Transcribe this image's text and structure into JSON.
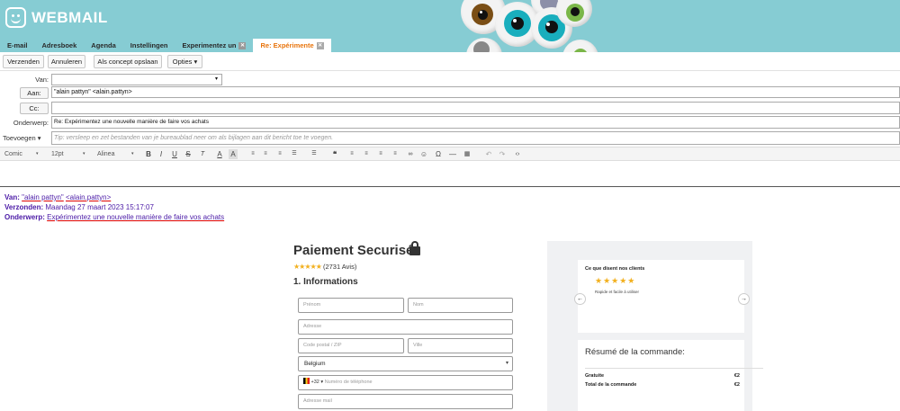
{
  "header": {
    "logo_text": "WEBMAIL",
    "tabs": [
      {
        "label": "E-mail",
        "closable": false,
        "active": false
      },
      {
        "label": "Adresboek",
        "closable": false,
        "active": false
      },
      {
        "label": "Agenda",
        "closable": false,
        "active": false
      },
      {
        "label": "Instellingen",
        "closable": false,
        "active": false
      },
      {
        "label": "Experimentez un",
        "closable": true,
        "active": false
      },
      {
        "label": "Re: Expérimente",
        "closable": true,
        "active": true
      }
    ],
    "close_glyph": "✕"
  },
  "toolbar": {
    "send": "Verzenden",
    "cancel": "Annuleren",
    "save_draft": "Als concept opslaan",
    "options": "Opties ▾"
  },
  "compose": {
    "from_label": "Van:",
    "from_value": "",
    "to_label": "Aan:",
    "to_value": "\"alain pattyn\" <alain.pattyn>",
    "cc_label": "Cc:",
    "cc_value": "",
    "subject_label": "Onderwerp:",
    "subject_value": "Re: Expérimentez une nouvelle manière de faire vos achats",
    "attach_label": "Toevoegen ▾",
    "attach_placeholder": "Tip: versleep en zet bestanden van je bureaublad neer om als bijlagen aan dit bericht toe te voegen."
  },
  "editor_toolbar": {
    "font": "Comic",
    "size": "12pt",
    "paragraph": "Alinea",
    "dropdown_glyph": "▾"
  },
  "quoted_header": {
    "from_label": "Van:",
    "from_name": "\"alain pattyn\"",
    "from_email": "<alain.pattyn>",
    "sent_label": "Verzonden:",
    "sent_value": "Maandag 27 maart 2023 15:17:07",
    "subject_label": "Onderwerp:",
    "subject_value": "Expérimentez une nouvelle manière de faire vos achats"
  },
  "checkout": {
    "title": "Paiement Securisé",
    "rating_stars": "★★★★★",
    "rating_text": "(2731 Avis)",
    "section_title": "1. Informations",
    "fields": {
      "prenom": "Prénom",
      "nom": "Nom",
      "adresse": "Adresse",
      "code_postal": "Code postal / ZIP",
      "ville": "Ville",
      "country": "Belgium",
      "phone_code": "+32 ▾",
      "phone": "Numéro de téléphone",
      "email": "Adresse mail"
    },
    "testimonials": {
      "heading": "Ce que disent nos clients",
      "stars": "★★★★★",
      "quote": "Rapide et facile à utiliser",
      "prev": "←",
      "next": "→"
    },
    "summary": {
      "heading": "Résumé de la commande:",
      "rows": [
        {
          "label": "Gratuite",
          "value": "€2"
        },
        {
          "label": "Total de la commande",
          "value": "€2"
        }
      ]
    }
  },
  "colors": {
    "header_bg": "#86ccd3",
    "active_tab_text": "#e8740c",
    "quoted_text": "#4b1aa6",
    "star": "#f2b01e"
  }
}
